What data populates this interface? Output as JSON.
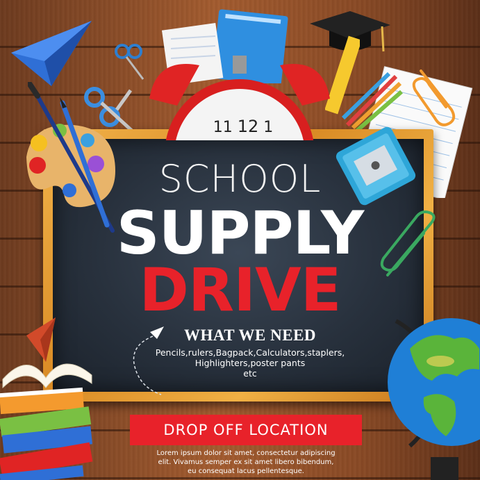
{
  "heading": {
    "line1": "SCHOOL",
    "line2": "SUPPLY",
    "line3": "DRIVE"
  },
  "needs": {
    "title": "WHAT WE NEED",
    "lines": [
      "Pencils,rulers,Bagpack,Calculators,staplers,",
      "Highlighters,poster pants",
      "etc"
    ]
  },
  "dropoff": {
    "label": "DROP OFF LOCATION",
    "lines": [
      "Lorem ipsum dolor sit amet, consectetur adipiscing",
      "elit. Vivamus semper ex sit amet libero bibendum,",
      "eu consequat lacus pellentesque."
    ]
  },
  "clock": {
    "numbers": [
      "11",
      "12",
      "1"
    ]
  },
  "colors": {
    "wood": "#8a4a25",
    "frame": "#e39a30",
    "chalkboard": "#2b3440",
    "accent_red": "#e8222a",
    "text_white": "#ffffff"
  },
  "decorations": [
    "paper-plane-icon",
    "alarm-clock-icon",
    "graduation-cap-icon",
    "paint-palette-icon",
    "paintbrush-icon",
    "pencil-icon",
    "scissors-icon",
    "pencil-sharpener-icon",
    "paper-clip-icon",
    "notebook-icon",
    "ruler-icon",
    "book-stack-icon",
    "globe-icon"
  ]
}
